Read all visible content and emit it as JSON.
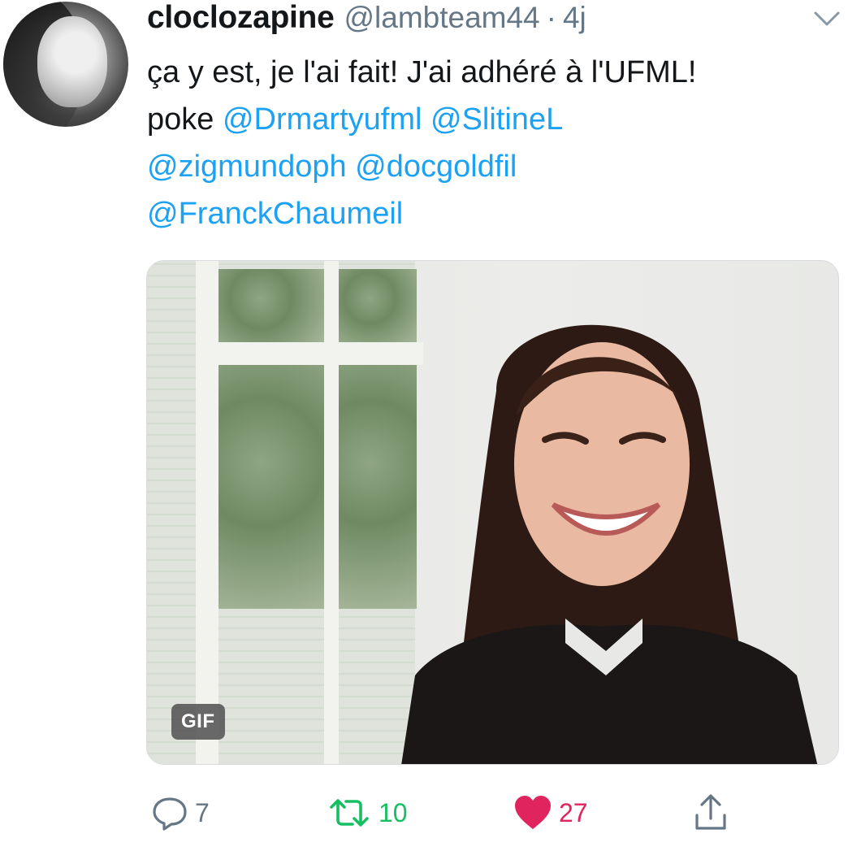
{
  "tweet": {
    "display_name": "cloclozapine",
    "handle": "@lambteam44",
    "separator": "·",
    "time": "4j",
    "text_line1": "ça y est, je l'ai fait! J'ai adhéré à l'UFML!",
    "text_poke": "poke",
    "mentions": [
      "@Drmartyufml",
      "@SlitineL",
      "@zigmundoph",
      "@docgoldfil",
      "@FranckChaumeil"
    ],
    "media_badge": "GIF"
  },
  "actions": {
    "reply_count": "7",
    "retweet_count": "10",
    "like_count": "27"
  },
  "icons": {
    "reply": "reply-bubble-icon",
    "retweet": "retweet-icon",
    "like": "heart-icon",
    "share": "share-icon",
    "caret": "chevron-down-icon"
  },
  "colors": {
    "link": "#1da1f2",
    "secondary": "#657786",
    "retweet": "#17bf63",
    "like": "#e0245e"
  }
}
